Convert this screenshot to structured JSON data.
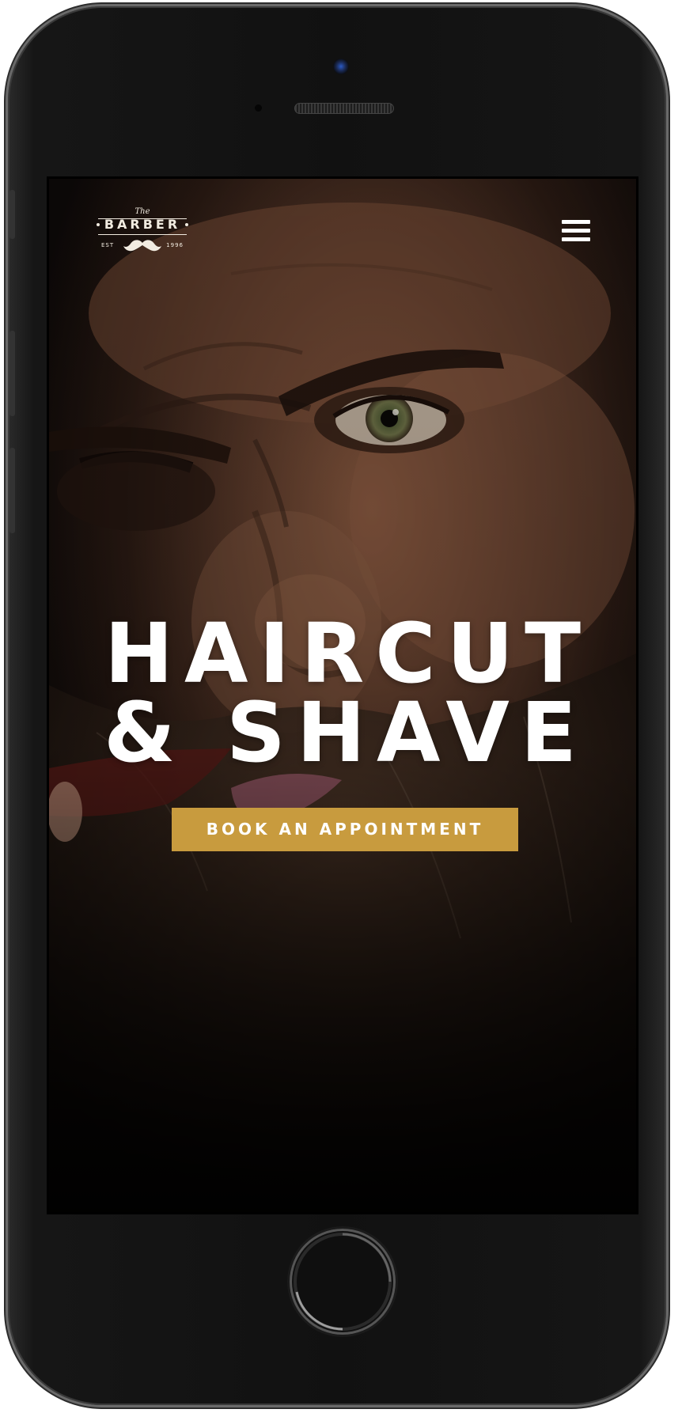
{
  "device": {
    "type": "smartphone",
    "frame_color": "#111111"
  },
  "site": {
    "logo": {
      "top_script": "The",
      "word": "BARBER",
      "est_label": "EST",
      "year": "1996",
      "icon": "mustache-icon"
    },
    "menu_icon": "hamburger-menu-icon"
  },
  "hero": {
    "headline_line1": "HAIRCUT",
    "headline_line2": "& SHAVE",
    "cta_label": "BOOK AN APPOINTMENT",
    "background_description_icon": "bearded-man-photo"
  },
  "colors": {
    "accent": "#c89b3e",
    "headline": "#ffffff",
    "overlay": "#0a0706"
  }
}
